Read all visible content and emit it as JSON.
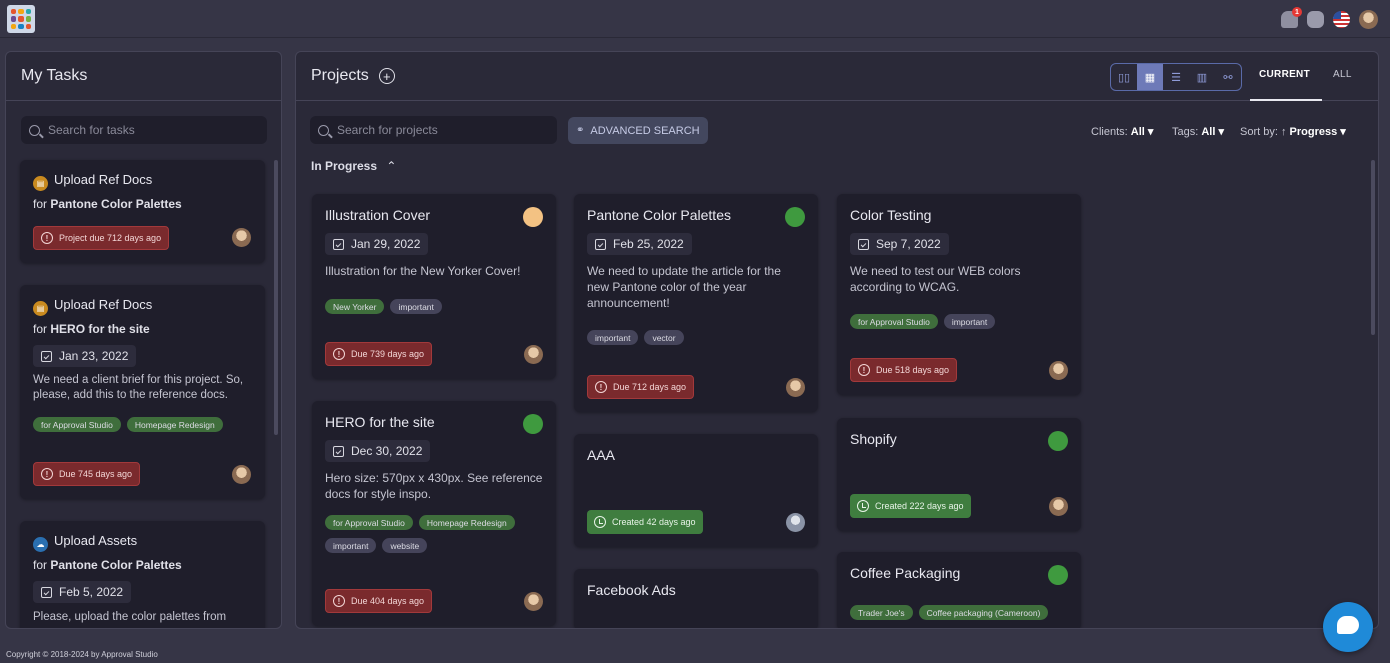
{
  "colors": {
    "accent": "#6e7ab8",
    "danger": "#7a2a2d",
    "success": "#3f7d3f"
  },
  "topbar": {
    "notification_count": "1",
    "icons": [
      "bell-icon",
      "database-icon",
      "us-flag-icon",
      "user-avatar"
    ]
  },
  "tasks": {
    "title": "My Tasks",
    "search_placeholder": "Search for tasks",
    "items": [
      {
        "label": "Upload Ref Docs",
        "for_prefix": "for",
        "project": "Pantone Color Palettes",
        "due": "Project due 712 days ago"
      },
      {
        "label": "Upload Ref Docs",
        "for_prefix": "for",
        "project": "HERO for the site",
        "date": "Jan 23, 2022",
        "desc": "We need a client brief for this project. So, please, add this to the reference docs.",
        "tags": [
          "for Approval Studio",
          "Homepage Redesign"
        ],
        "due": "Due 745 days ago"
      },
      {
        "label": "Upload Assets",
        "for_prefix": "for",
        "project": "Pantone Color Palettes",
        "date": "Feb 5, 2022",
        "desc": "Please, upload the color palettes from"
      }
    ]
  },
  "projects": {
    "title": "Projects",
    "search_placeholder": "Search for projects",
    "advanced_search": "ADVANCED SEARCH",
    "tabs": {
      "current": "CURRENT",
      "all": "ALL"
    },
    "filters": {
      "clients_label": "Clients:",
      "clients_value": "All",
      "tags_label": "Tags:",
      "tags_value": "All",
      "sort_label": "Sort by:",
      "sort_value": "Progress"
    },
    "section": "In Progress",
    "cards": [
      {
        "title": "Illustration Cover",
        "date": "Jan 29, 2022",
        "desc": "Illustration for the New Yorker Cover!",
        "tags": [
          "New Yorker",
          "important"
        ],
        "status": "Due 739 days ago",
        "dot": "#f3c283"
      },
      {
        "title": "HERO for the site",
        "date": "Dec 30, 2022",
        "desc": "Hero size: 570px x 430px. See reference docs for style inspo.",
        "tags": [
          "for Approval Studio",
          "Homepage Redesign",
          "important",
          "website"
        ],
        "status": "Due 404 days ago",
        "dot": "#3f9a3f"
      },
      {
        "title": "Pantone Color Palettes",
        "date": "Feb 25, 2022",
        "desc": "We need to update the article for the new Pantone color of the year announcement!",
        "tags": [
          "important",
          "vector"
        ],
        "status": "Due 712 days ago",
        "dot": "#3f9a3f"
      },
      {
        "title": "AAA",
        "status": "Created 42 days ago"
      },
      {
        "title": "Facebook Ads"
      },
      {
        "title": "Color Testing",
        "date": "Sep 7, 2022",
        "desc": "We need to test our WEB colors according to WCAG.",
        "tags": [
          "for Approval Studio",
          "important"
        ],
        "status": "Due 518 days ago"
      },
      {
        "title": "Shopify",
        "status": "Created 222 days ago",
        "dot": "#3f9a3f"
      },
      {
        "title": "Coffee Packaging",
        "tags": [
          "Trader Joe's",
          "Coffee packaging (Cameroon)"
        ],
        "dot": "#3f9a3f"
      }
    ]
  },
  "footer": "Copyright © 2018-2024 by Approval Studio"
}
